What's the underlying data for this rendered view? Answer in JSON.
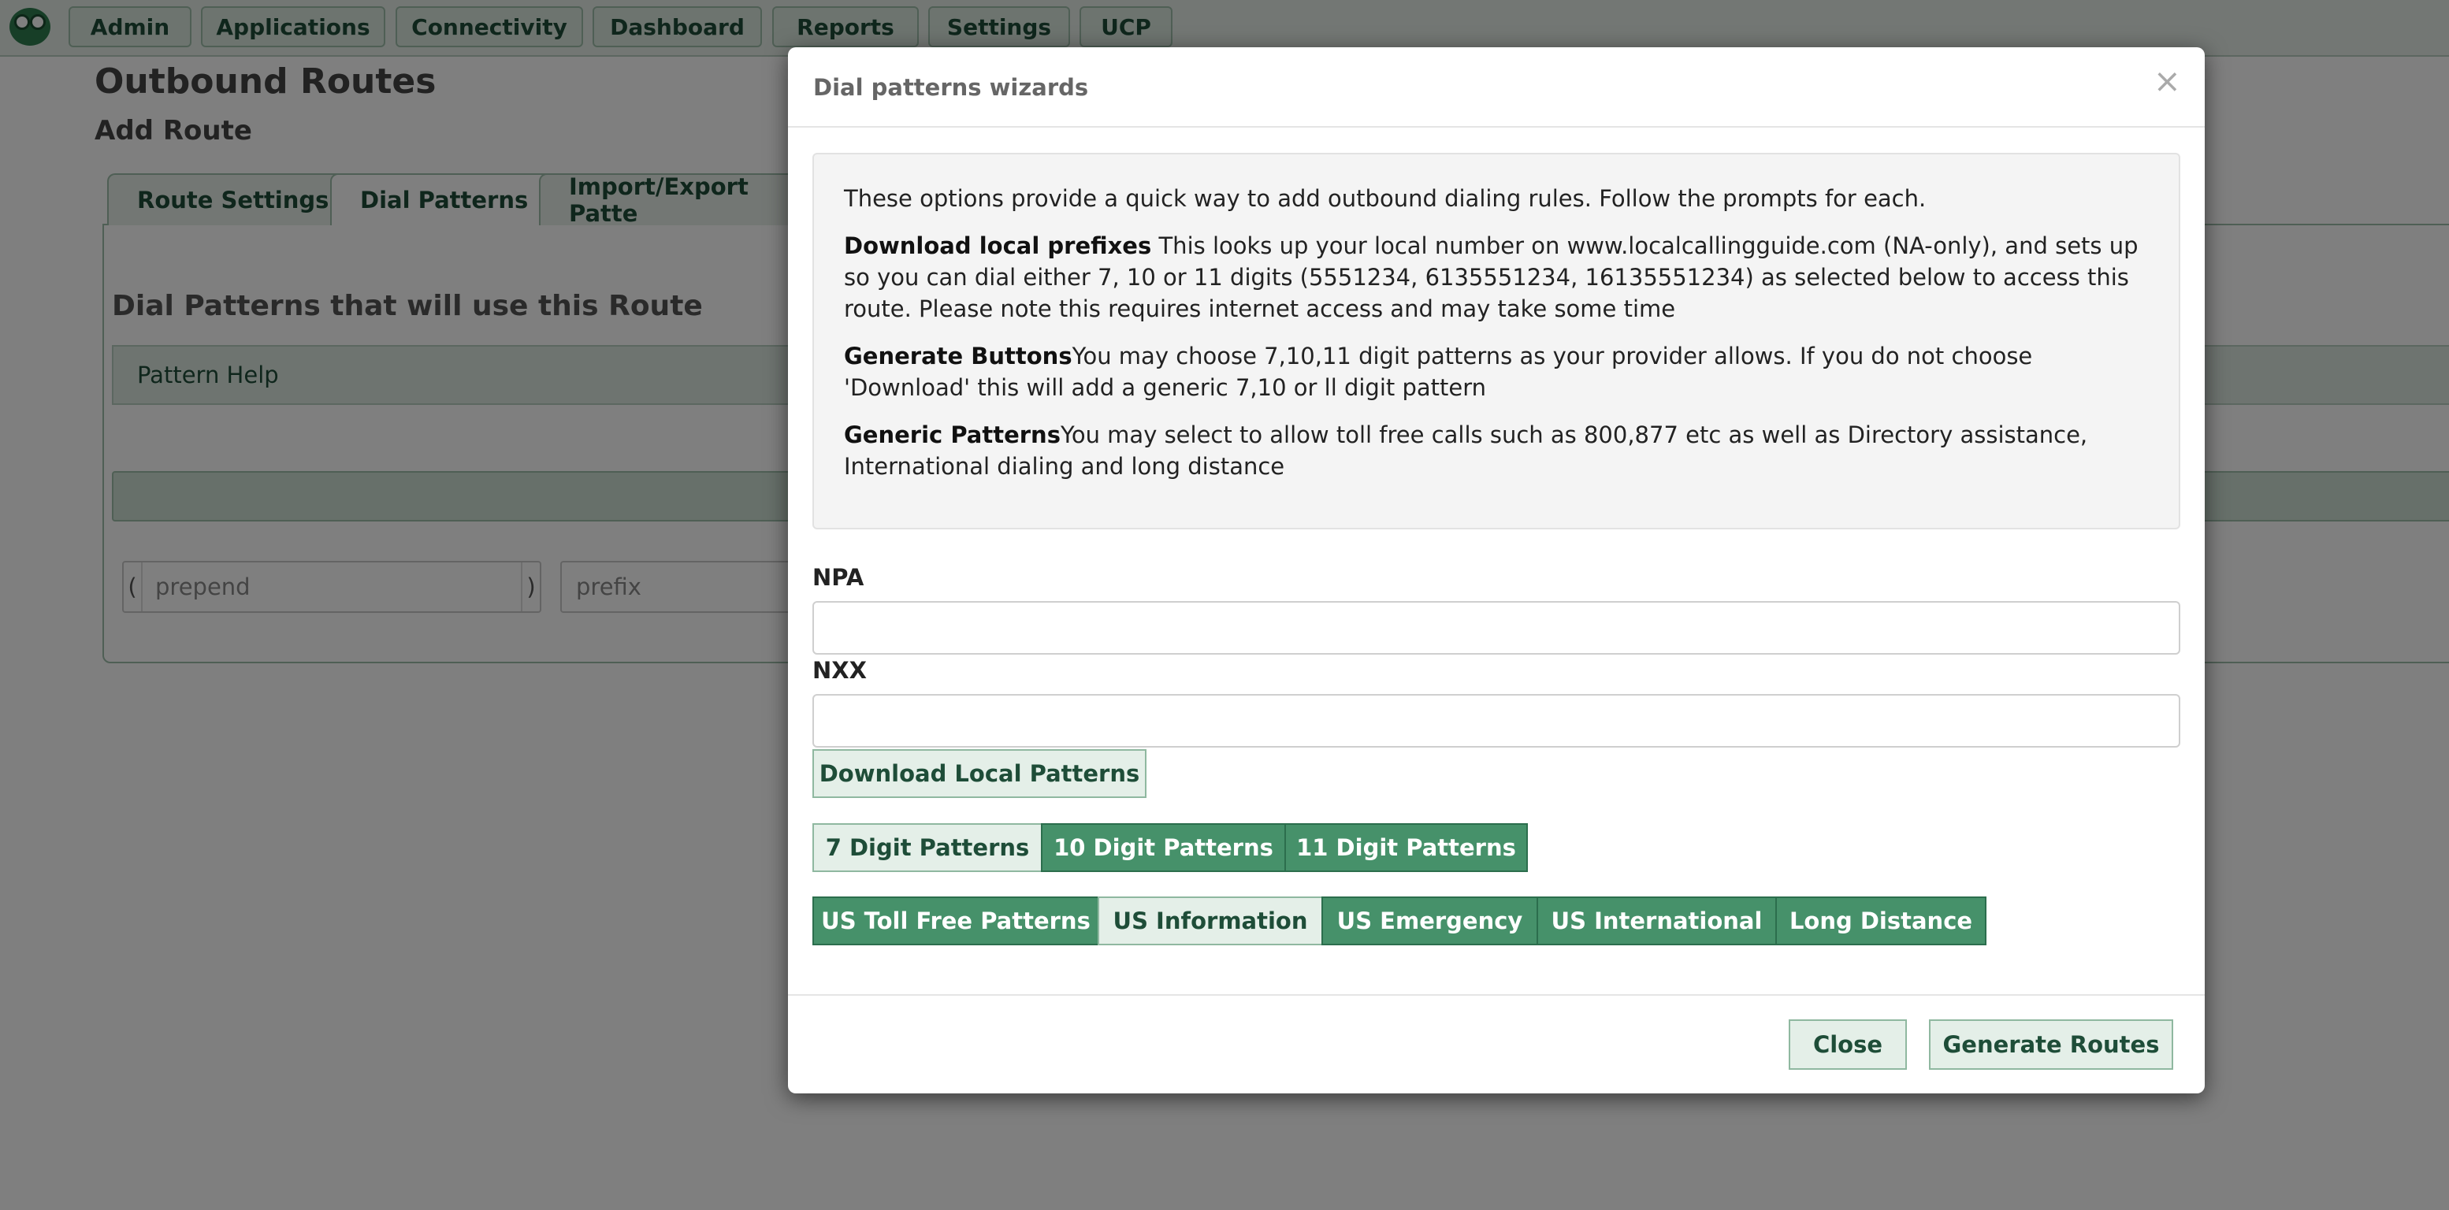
{
  "nav": {
    "items": [
      "Admin",
      "Applications",
      "Connectivity",
      "Dashboard",
      "Reports",
      "Settings",
      "UCP"
    ]
  },
  "page": {
    "title": "Outbound Routes",
    "subtitle": "Add Route",
    "tabs": [
      "Route Settings",
      "Dial Patterns",
      "Import/Export Patte"
    ],
    "section_heading": "Dial Patterns that will use this Route",
    "pattern_help": "Pattern Help",
    "row": {
      "open_paren": "(",
      "close_paren": ")",
      "prepend_placeholder": "prepend",
      "prefix_placeholder": "prefix"
    }
  },
  "modal": {
    "title": "Dial patterns wizards",
    "close_symbol": "×",
    "intro": "These options provide a quick way to add outbound dialing rules. Follow the prompts for each.",
    "download": {
      "label": "Download local prefixes",
      "text": " This looks up your local number on www.localcallingguide.com (NA-only), and sets up so you can dial either 7, 10 or 11 digits (5551234, 6135551234, 16135551234) as selected below to access this route. Please note this requires internet access and may take some time"
    },
    "generate": {
      "label": "Generate Buttons",
      "text": "You may choose 7,10,11 digit patterns as your provider allows. If you do not choose 'Download' this will add a generic 7,10 or ll digit pattern"
    },
    "generic": {
      "label": "Generic Patterns",
      "text": "You may select to allow toll free calls such as 800,877 etc as well as Directory assistance, International dialing and long distance"
    },
    "npa_label": "NPA",
    "npa_value": "",
    "nxx_label": "NXX",
    "nxx_value": "",
    "download_button": "Download Local Patterns",
    "digit_buttons": [
      "7 Digit Patterns",
      "10 Digit Patterns",
      "11 Digit Patterns"
    ],
    "generic_buttons": [
      "US Toll Free Patterns",
      "US Information",
      "US Emergency",
      "US International",
      "Long Distance"
    ],
    "close_button": "Close",
    "generate_button": "Generate Routes"
  }
}
